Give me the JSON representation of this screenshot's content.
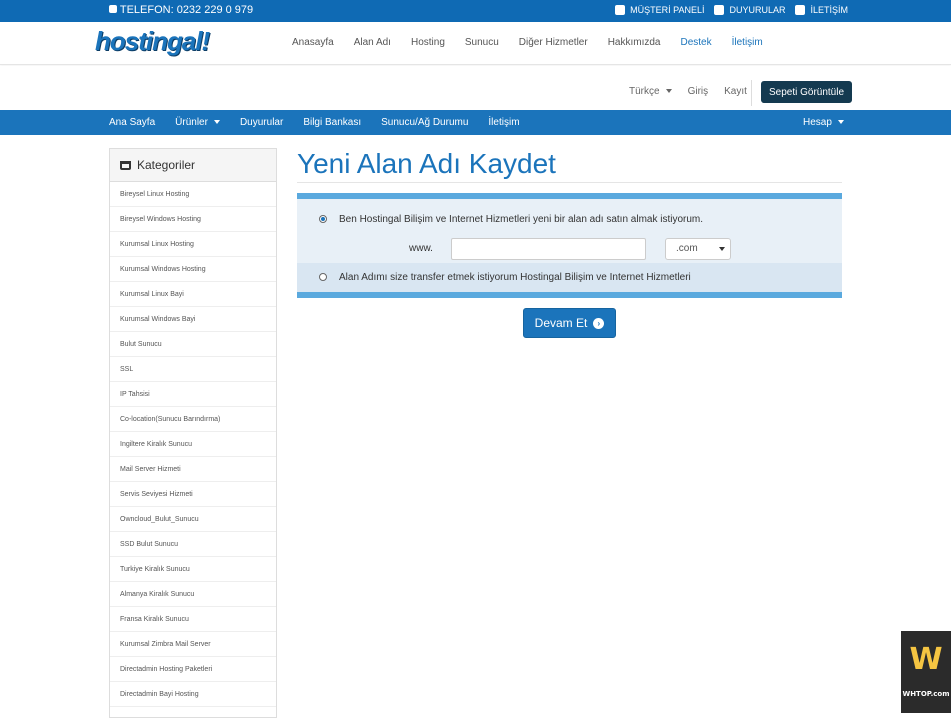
{
  "topbar": {
    "phone": "TELEFON: 0232 229 0 979",
    "links": [
      "MÜŞTERİ PANELİ",
      "DUYURULAR",
      "İLETİŞİM"
    ]
  },
  "header": {
    "logo": "hostingal!",
    "nav": [
      "Anasayfa",
      "Alan Adı",
      "Hosting",
      "Sunucu",
      "Diğer Hizmetler",
      "Hakkımızda",
      "Destek",
      "İletişim"
    ]
  },
  "subbar": {
    "language": "Türkçe",
    "login": "Giriş",
    "register": "Kayıt",
    "cart_button": "Sepeti Görüntüle"
  },
  "navbar": {
    "items": [
      "Ana Sayfa",
      "Ürünler",
      "Duyurular",
      "Bilgi Bankası",
      "Sunucu/Ağ Durumu",
      "İletişim"
    ],
    "account": "Hesap"
  },
  "sidebar": {
    "title": "Kategoriler",
    "items": [
      "Bireysel Linux Hosting",
      "Bireysel Windows Hosting",
      "Kurumsal Linux Hosting",
      "Kurumsal Windows Hosting",
      "Kurumsal Linux Bayi",
      "Kurumsal Windows Bayi",
      "Bulut Sunucu",
      "SSL",
      "IP Tahsisi",
      "Co-location(Sunucu Barındırma)",
      "Ingiltere Kiralık Sunucu",
      "Mail Server Hizmeti",
      "Servis Seviyesi Hizmeti",
      "Owncloud_Bulut_Sunucu",
      "SSD Bulut Sunucu",
      "Turkiye Kiralık Sunucu",
      "Almanya Kiralık Sunucu",
      "Fransa Kiralık Sunucu",
      "Kurumsal Zimbra Mail Server",
      "Directadmin Hosting Paketleri",
      "Directadmin Bayi Hosting"
    ]
  },
  "main": {
    "title": "Yeni Alan Adı Kaydet",
    "option_register": "Ben Hostingal Bilişim ve Internet Hizmetleri yeni bir alan adı satın almak istiyorum.",
    "www_label": "www.",
    "domain_value": "",
    "tld_selected": ".com",
    "option_transfer": "Alan Adımı size transfer etmek istiyorum Hostingal Bilişim ve Internet Hizmetleri",
    "continue_button": "Devam Et"
  },
  "watermark": {
    "text": "WHTOP.com"
  }
}
